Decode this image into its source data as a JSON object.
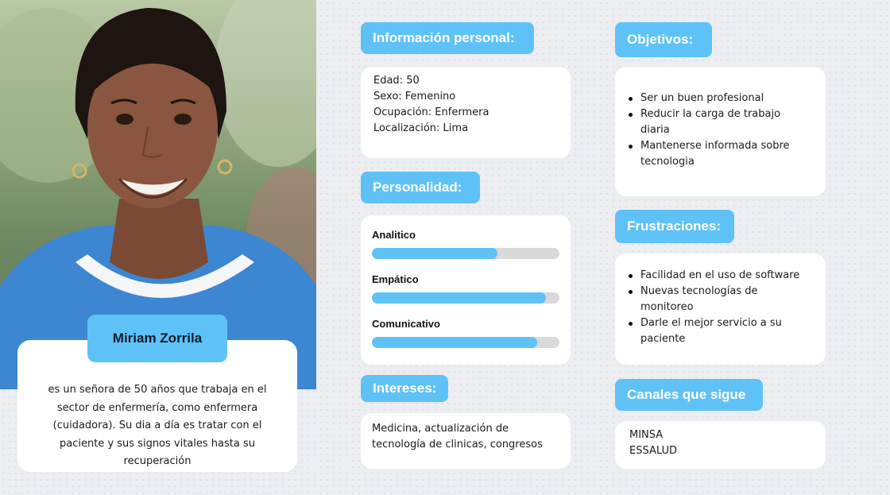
{
  "persona": {
    "name": "Miriam Zorrila",
    "bio": "es un señora de 50 años que trabaja en el sector de enfermería, como enfermera (cuidadora). Su dia a día es tratar con el paciente y sus signos vitales hasta su recuperación"
  },
  "personal_info": {
    "title": "Información personal:",
    "lines": [
      "Edad: 50",
      "Sexo: Femenino",
      "Ocupación: Enfermera",
      "Localización: Lima"
    ]
  },
  "personality": {
    "title": "Personalidad:",
    "traits": [
      {
        "label": "Analitico",
        "level": 0.67
      },
      {
        "label": "Empático",
        "level": 0.93
      },
      {
        "label": "Comunicativo",
        "level": 0.88
      }
    ]
  },
  "interests": {
    "title": "Intereses:",
    "text": "Medicina, actualización de tecnología de clinicas, congresos"
  },
  "goals": {
    "title": "Objetivos:",
    "items": [
      "Ser un buen profesional",
      "Reducir la carga de trabajo diaria",
      "Mantenerse informada sobre tecnologia"
    ]
  },
  "frustrations": {
    "title": "Frustraciones:",
    "items": [
      "Facilidad en el uso de software",
      "Nuevas tecnologías de monitoreo",
      "Darle el mejor servicio a su paciente"
    ]
  },
  "channels": {
    "title": "Canales que sigue",
    "items": [
      "MINSA",
      "ESSALUD"
    ]
  },
  "colors": {
    "accent": "#5ec2f7",
    "track": "#d9d9d9",
    "card": "#ffffff"
  }
}
